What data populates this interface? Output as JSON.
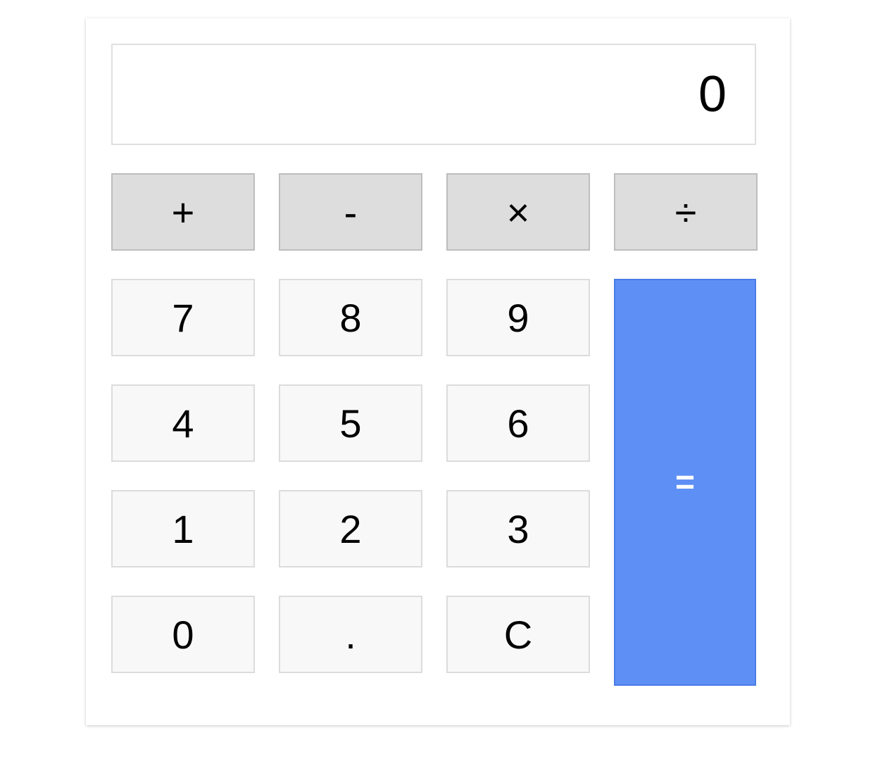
{
  "display": {
    "value": "0"
  },
  "operators": {
    "add": "+",
    "subtract": "-",
    "multiply": "×",
    "divide": "÷"
  },
  "digits": {
    "seven": "7",
    "eight": "8",
    "nine": "9",
    "four": "4",
    "five": "5",
    "six": "6",
    "one": "1",
    "two": "2",
    "three": "3",
    "zero": "0",
    "decimal": ".",
    "clear": "C"
  },
  "equals": "=",
  "colors": {
    "operator_bg": "#dddddd",
    "number_bg": "#f8f8f8",
    "equals_bg": "#5e8ff5",
    "equals_text": "#ffffff"
  }
}
